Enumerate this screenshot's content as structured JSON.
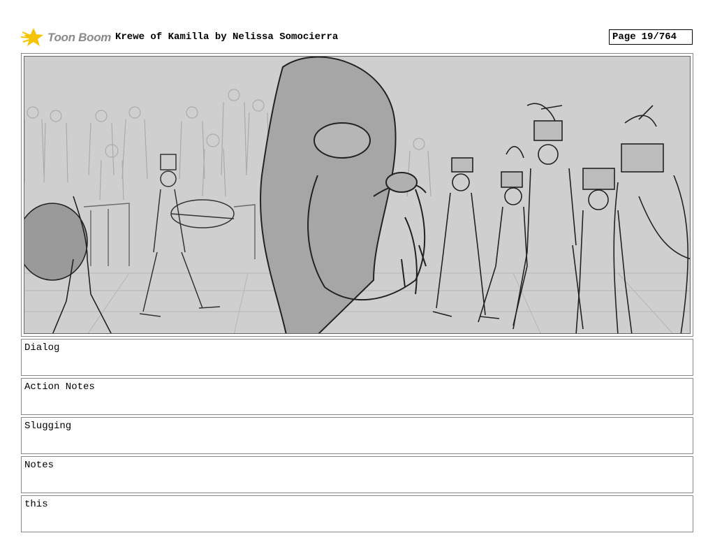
{
  "header": {
    "logo_text": "Toon Boom",
    "title": "Krewe of Kamilla by Nelissa Somocierra",
    "page_label": "Page",
    "page_value": "19/764"
  },
  "panel": {
    "image_icon": "storyboard-sketch"
  },
  "fields": [
    {
      "label": "Dialog"
    },
    {
      "label": "Action Notes"
    },
    {
      "label": "Slugging"
    },
    {
      "label": "Notes"
    },
    {
      "label": "this"
    }
  ],
  "colors": {
    "logo_star": "#f5c400",
    "logo_text": "#8a8a8a",
    "panel_bg": "#cfcfcf"
  }
}
